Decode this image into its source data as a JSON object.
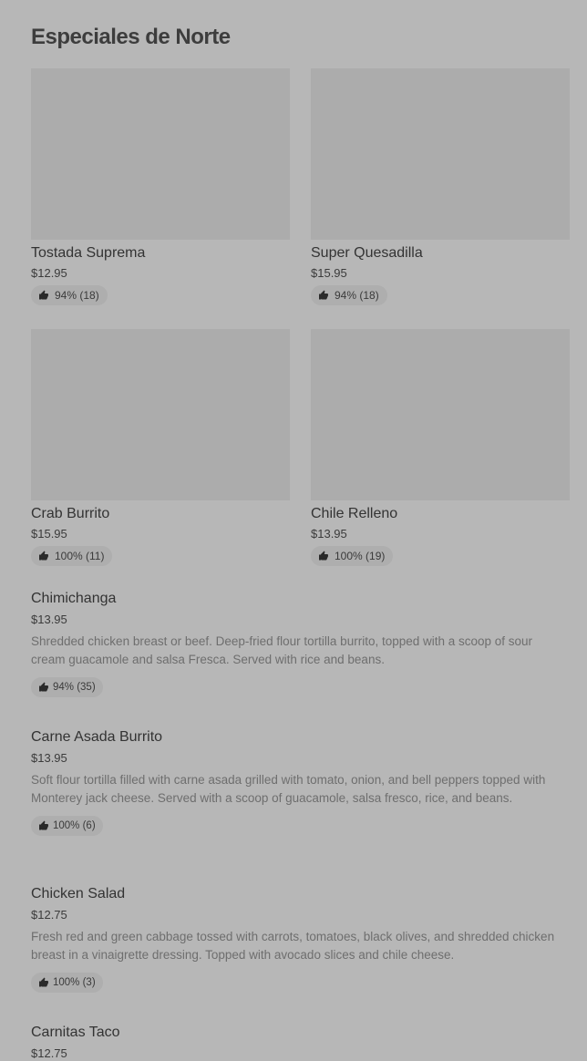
{
  "section": {
    "title": "Especiales de Norte"
  },
  "cards": [
    {
      "name": "Tostada Suprema",
      "price": "$12.95",
      "rating": "94% (18)"
    },
    {
      "name": "Super Quesadilla",
      "price": "$15.95",
      "rating": "94% (18)"
    },
    {
      "name": "Crab Burrito",
      "price": "$15.95",
      "rating": "100% (11)"
    },
    {
      "name": "Chile Relleno",
      "price": "$13.95",
      "rating": "100% (19)"
    }
  ],
  "items": [
    {
      "name": "Chimichanga",
      "price": "$13.95",
      "description": "Shredded chicken breast or beef. Deep-fried flour tortilla burrito, topped with a scoop of sour cream guacamole and salsa Fresca. Served with rice and beans.",
      "rating": "94% (35)"
    },
    {
      "name": "Carne Asada Burrito",
      "price": "$13.95",
      "description": "Soft flour tortilla filled with carne asada grilled with tomato, onion, and bell peppers topped with Monterey jack cheese. Served with a scoop of guacamole, salsa fresco, rice, and beans.",
      "rating": "100% (6)"
    },
    {
      "name": "Chicken Salad",
      "price": "$12.75",
      "description": "Fresh red and green cabbage tossed with carrots, tomatoes, black olives, and shredded chicken breast in a vinaigrette dressing. Topped with avocado slices and chile cheese.",
      "rating": "100% (3)"
    },
    {
      "name": "Carnitas Taco",
      "price": "$12.75"
    }
  ],
  "icons": {
    "rating": "thumbs-up-icon"
  }
}
